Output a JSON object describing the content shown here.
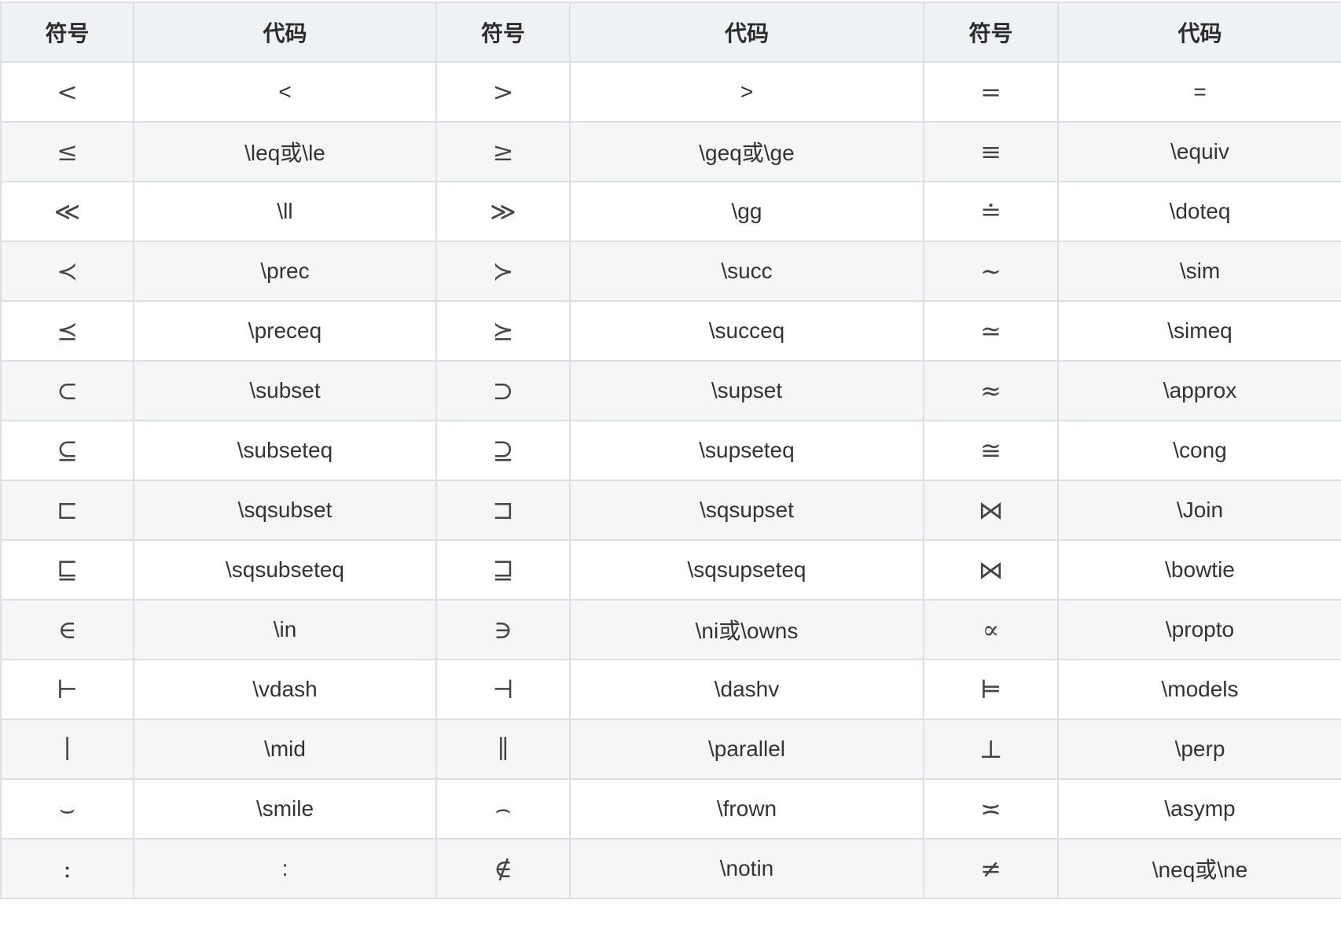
{
  "header": [
    "符号",
    "代码",
    "符号",
    "代码",
    "符号",
    "代码"
  ],
  "rows": [
    [
      "<",
      "<",
      ">",
      ">",
      "=",
      "="
    ],
    [
      "≤",
      "\\leq或\\le",
      "≥",
      "\\geq或\\ge",
      "≡",
      "\\equiv"
    ],
    [
      "≪",
      "\\ll",
      "≫",
      "\\gg",
      "≐",
      "\\doteq"
    ],
    [
      "≺",
      "\\prec",
      "≻",
      "\\succ",
      "∼",
      "\\sim"
    ],
    [
      "⪯",
      "\\preceq",
      "⪰",
      "\\succeq",
      "≃",
      "\\simeq"
    ],
    [
      "⊂",
      "\\subset",
      "⊃",
      "\\supset",
      "≈",
      "\\approx"
    ],
    [
      "⊆",
      "\\subseteq",
      "⊇",
      "\\supseteq",
      "≅",
      "\\cong"
    ],
    [
      "⊏",
      "\\sqsubset",
      "⊐",
      "\\sqsupset",
      "⋈",
      "\\Join"
    ],
    [
      "⊑",
      "\\sqsubseteq",
      "⊒",
      "\\sqsupseteq",
      "⋈",
      "\\bowtie"
    ],
    [
      "∈",
      "\\in",
      "∋",
      "\\ni或\\owns",
      "∝",
      "\\propto"
    ],
    [
      "⊢",
      "\\vdash",
      "⊣",
      "\\dashv",
      "⊨",
      "\\models"
    ],
    [
      "∣",
      "\\mid",
      "∥",
      "\\parallel",
      "⊥",
      "\\perp"
    ],
    [
      "⌣",
      "\\smile",
      "⌢",
      "\\frown",
      "≍",
      "\\asymp"
    ],
    [
      ":",
      ":",
      "∉",
      "\\notin",
      "≠",
      "\\neq或\\ne"
    ]
  ]
}
